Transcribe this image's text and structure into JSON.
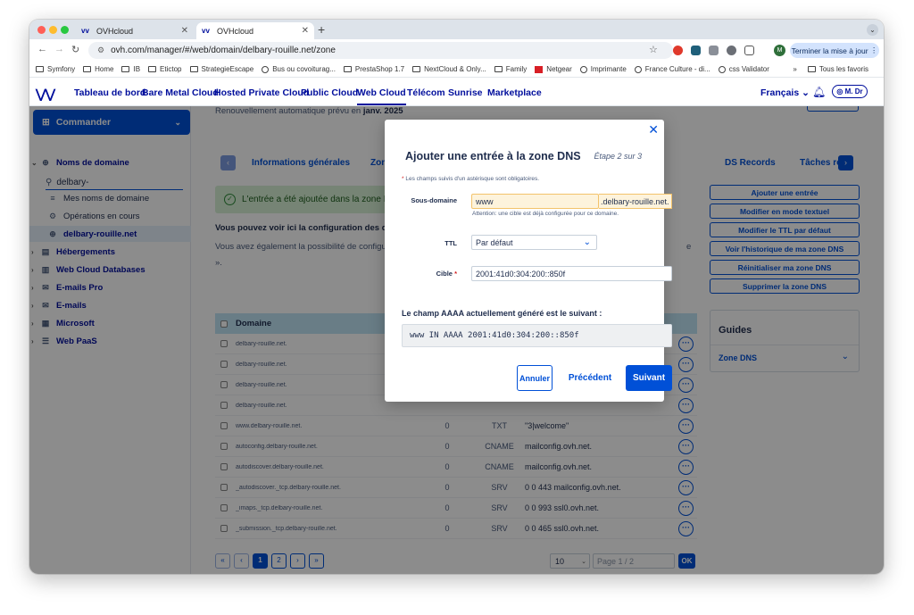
{
  "browser": {
    "tabs": [
      {
        "title": "OVHcloud",
        "active": false
      },
      {
        "title": "OVHcloud",
        "active": true
      }
    ],
    "url": "ovh.com/manager/#/web/domain/delbary-rouille.net/zone",
    "update_button": "Terminer la mise à jour",
    "profile_initial": "M",
    "bookmarks": [
      "Symfony",
      "Home",
      "IB",
      "Etictop",
      "StrategieEscape",
      "Bus ou covoiturag...",
      "PrestaShop 1.7",
      "NextCloud & Only...",
      "Family",
      "Netgear",
      "Imprimante",
      "France Culture - di...",
      "css Validator"
    ],
    "bookmarks_more": "»",
    "all_bookmarks": "Tous les favoris"
  },
  "topnav": {
    "items": [
      "Tableau de bord",
      "Bare Metal Cloud",
      "Hosted Private Cloud",
      "Public Cloud",
      "Web Cloud",
      "Télécom",
      "Sunrise",
      "Marketplace"
    ],
    "active": "Web Cloud",
    "language": "Français",
    "user": "M. Dr"
  },
  "sidebar": {
    "order_label": "Commander",
    "items": [
      {
        "label": "Noms de domaine",
        "level": 0,
        "icon": "globe-icon"
      },
      {
        "label": "Mes noms de domaine",
        "level": 1,
        "icon": "list-icon"
      },
      {
        "label": "Opérations en cours",
        "level": 1,
        "icon": "gear-icon"
      },
      {
        "label": "delbary-rouille.net",
        "level": 1,
        "icon": "globe-icon",
        "selected": true
      },
      {
        "label": "Hébergements",
        "level": 0,
        "icon": "server-icon"
      },
      {
        "label": "Web Cloud Databases",
        "level": 0,
        "icon": "database-icon"
      },
      {
        "label": "E-mails Pro",
        "level": 0,
        "icon": "mail-icon"
      },
      {
        "label": "E-mails",
        "level": 0,
        "icon": "mail-icon"
      },
      {
        "label": "Microsoft",
        "level": 0,
        "icon": "windows-icon"
      },
      {
        "label": "Web PaaS",
        "level": 0,
        "icon": "stack-icon"
      }
    ],
    "search_value": "delbary-"
  },
  "main": {
    "renewal_text": "Renouvellement automatique prévu en ",
    "renewal_date": "janv. 2025",
    "subtabs": [
      "Informations générales",
      "Zone",
      "DS Records",
      "Tâches ré"
    ],
    "success_message": "L'entrée a été ajoutée dans la zone DNS, m",
    "info_bold": "Vous pouvez voir ici la configuration des divers",
    "info_text": "Vous avez également la possibilité de configurer c",
    "info_text_end": "e",
    "info_text_line2": "».",
    "actions": [
      "Ajouter une entrée",
      "Modifier en mode textuel",
      "Modifier le TTL par défaut",
      "Voir l'historique de ma zone DNS",
      "Réinitialiser ma zone DNS",
      "Supprimer la zone DNS"
    ],
    "guides": {
      "title": "Guides",
      "item": "Zone DNS"
    },
    "table": {
      "header": "Domaine",
      "rows": [
        {
          "domain": "delbary-rouille.net.",
          "ttl": "",
          "type": "",
          "target": ""
        },
        {
          "domain": "delbary-rouille.net.",
          "ttl": "",
          "type": "",
          "target": ""
        },
        {
          "domain": "delbary-rouille.net.",
          "ttl": "",
          "type": "",
          "target": ""
        },
        {
          "domain": "delbary-rouille.net.",
          "ttl": "",
          "type": "",
          "target": ""
        },
        {
          "domain": "www.delbary-rouille.net.",
          "ttl": "0",
          "type": "TXT",
          "target": "\"3|welcome\""
        },
        {
          "domain": "autoconfig.delbary-rouille.net.",
          "ttl": "0",
          "type": "CNAME",
          "target": "mailconfig.ovh.net."
        },
        {
          "domain": "autodiscover.delbary-rouille.net.",
          "ttl": "0",
          "type": "CNAME",
          "target": "mailconfig.ovh.net."
        },
        {
          "domain": "_autodiscover._tcp.delbary-rouille.net.",
          "ttl": "0",
          "type": "SRV",
          "target": "0 0 443 mailconfig.ovh.net."
        },
        {
          "domain": "_imaps._tcp.delbary-rouille.net.",
          "ttl": "0",
          "type": "SRV",
          "target": "0 0 993 ssl0.ovh.net."
        },
        {
          "domain": "_submission._tcp.delbary-rouille.net.",
          "ttl": "0",
          "type": "SRV",
          "target": "0 0 465 ssl0.ovh.net."
        }
      ]
    },
    "pager": {
      "pages": [
        "1",
        "2"
      ],
      "current": "1",
      "per_page": "10",
      "page_of_placeholder": "Page 1 / 2",
      "ok_label": "OK"
    }
  },
  "modal": {
    "title": "Ajouter une entrée à la zone DNS",
    "step": "Étape 2 sur 3",
    "required_note": "Les champs suivis d'un astérisque sont obligatoires.",
    "subdomain_label": "Sous-domaine",
    "subdomain_value": "www",
    "domain_suffix": ".delbary-rouille.net.",
    "warning_message": "Attention: une cible est déjà configurée pour ce domaine.",
    "ttl_label": "TTL",
    "ttl_value": "Par défaut",
    "target_label": "Cible",
    "target_value": "2001:41d0:304:200::850f",
    "generated_label": "Le champ AAAA actuellement généré est le suivant :",
    "generated_value": "www IN AAAA 2001:41d0:304:200::850f",
    "cancel": "Annuler",
    "previous": "Précédent",
    "next": "Suivant"
  }
}
